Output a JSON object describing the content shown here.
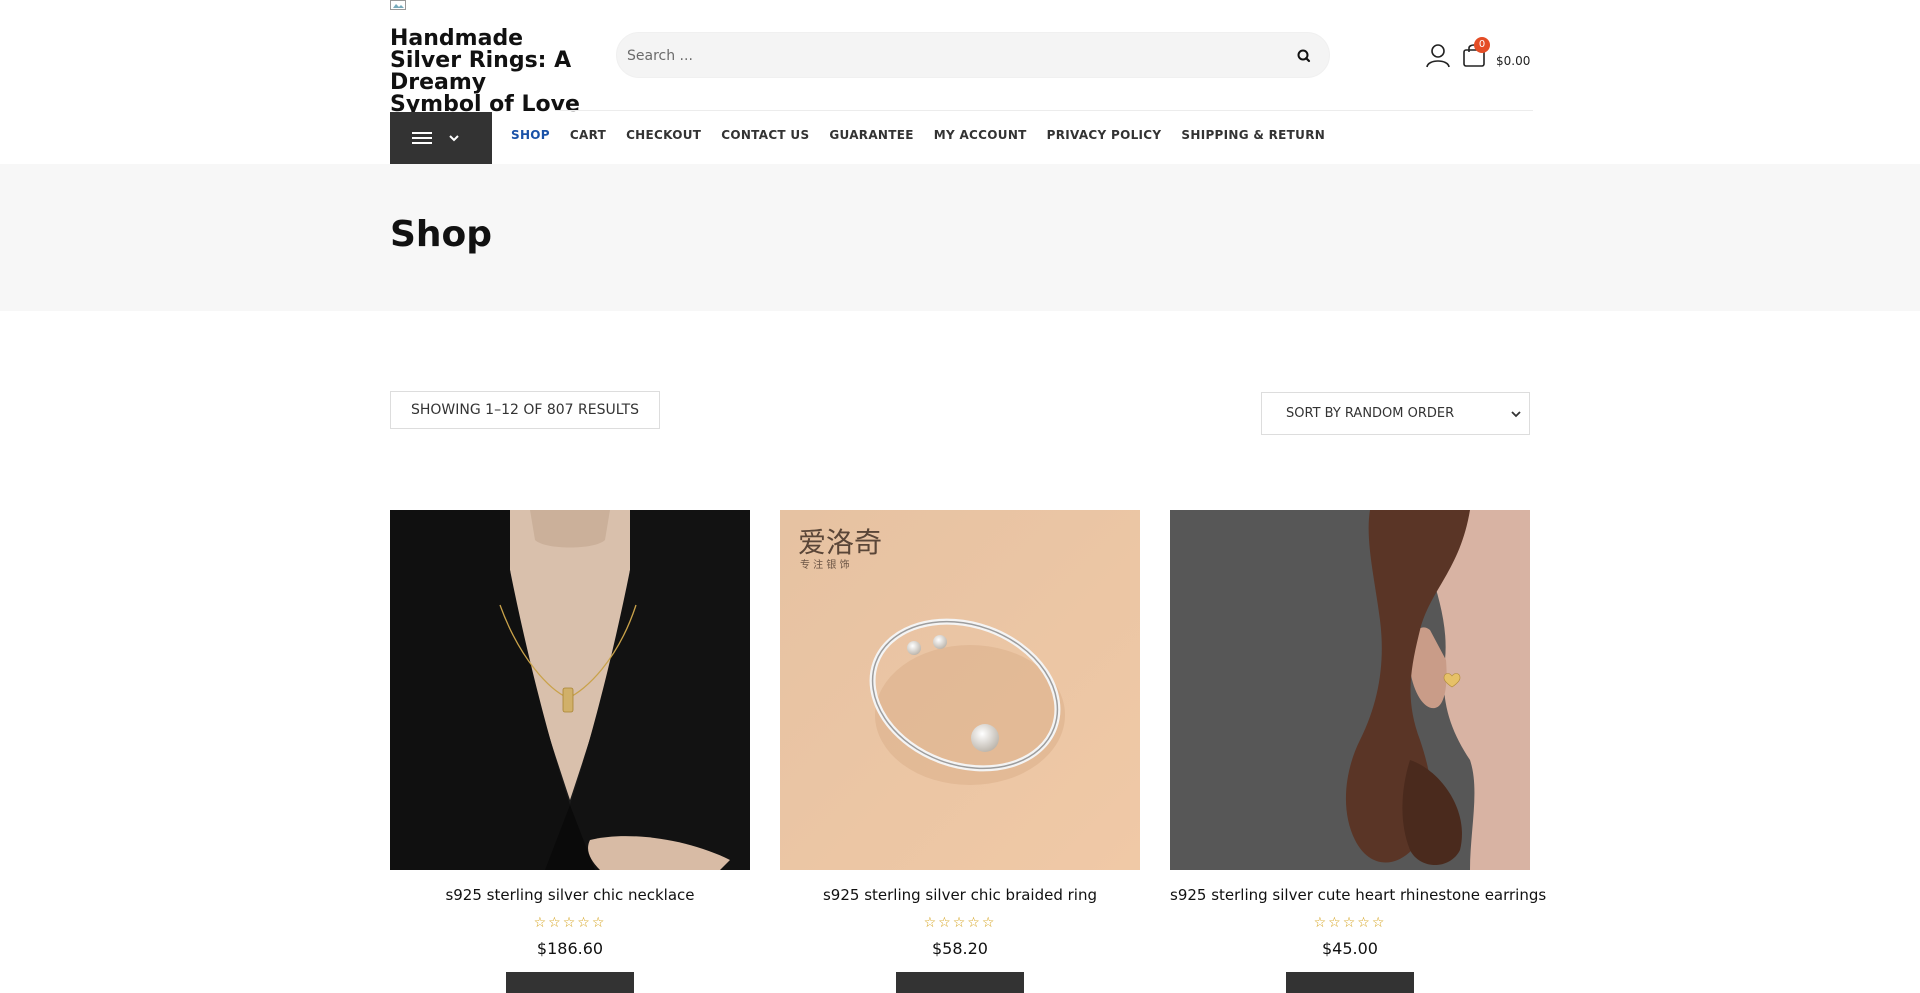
{
  "header": {
    "site_title": "Handmade Silver Rings: A Dreamy Symbol of Love",
    "search_placeholder": "Search ...",
    "cart_count": "0",
    "cart_total": "$0.00"
  },
  "nav": {
    "items": [
      "SHOP",
      "CART",
      "CHECKOUT",
      "CONTACT US",
      "GUARANTEE",
      "MY ACCOUNT",
      "PRIVACY POLICY",
      "SHIPPING & RETURN"
    ],
    "active": "SHOP"
  },
  "page": {
    "title": "Shop",
    "result_count": "SHOWING 1–12 OF 807 RESULTS",
    "sort_selected": "SORT BY RANDOM ORDER"
  },
  "products": [
    {
      "name": "s925 sterling silver chic necklace",
      "price": "$186.60",
      "rating": 0,
      "max_rating": 5,
      "stars": "☆☆☆☆☆"
    },
    {
      "name": "s925 sterling silver chic braided ring",
      "price": "$58.20",
      "rating": 0,
      "max_rating": 5,
      "stars": "☆☆☆☆☆",
      "image_caption_cn": "爱洛奇",
      "image_sub_cn": "专 注 银 饰"
    },
    {
      "name": "s925 sterling silver cute heart rhinestone earrings",
      "price": "$45.00",
      "rating": 0,
      "max_rating": 5,
      "stars": "☆☆☆☆☆"
    }
  ],
  "colors": {
    "accent_nav": "#1a52a8",
    "cart_badge": "#e44d26",
    "dark_button": "#333333",
    "star": "#d4a017"
  }
}
